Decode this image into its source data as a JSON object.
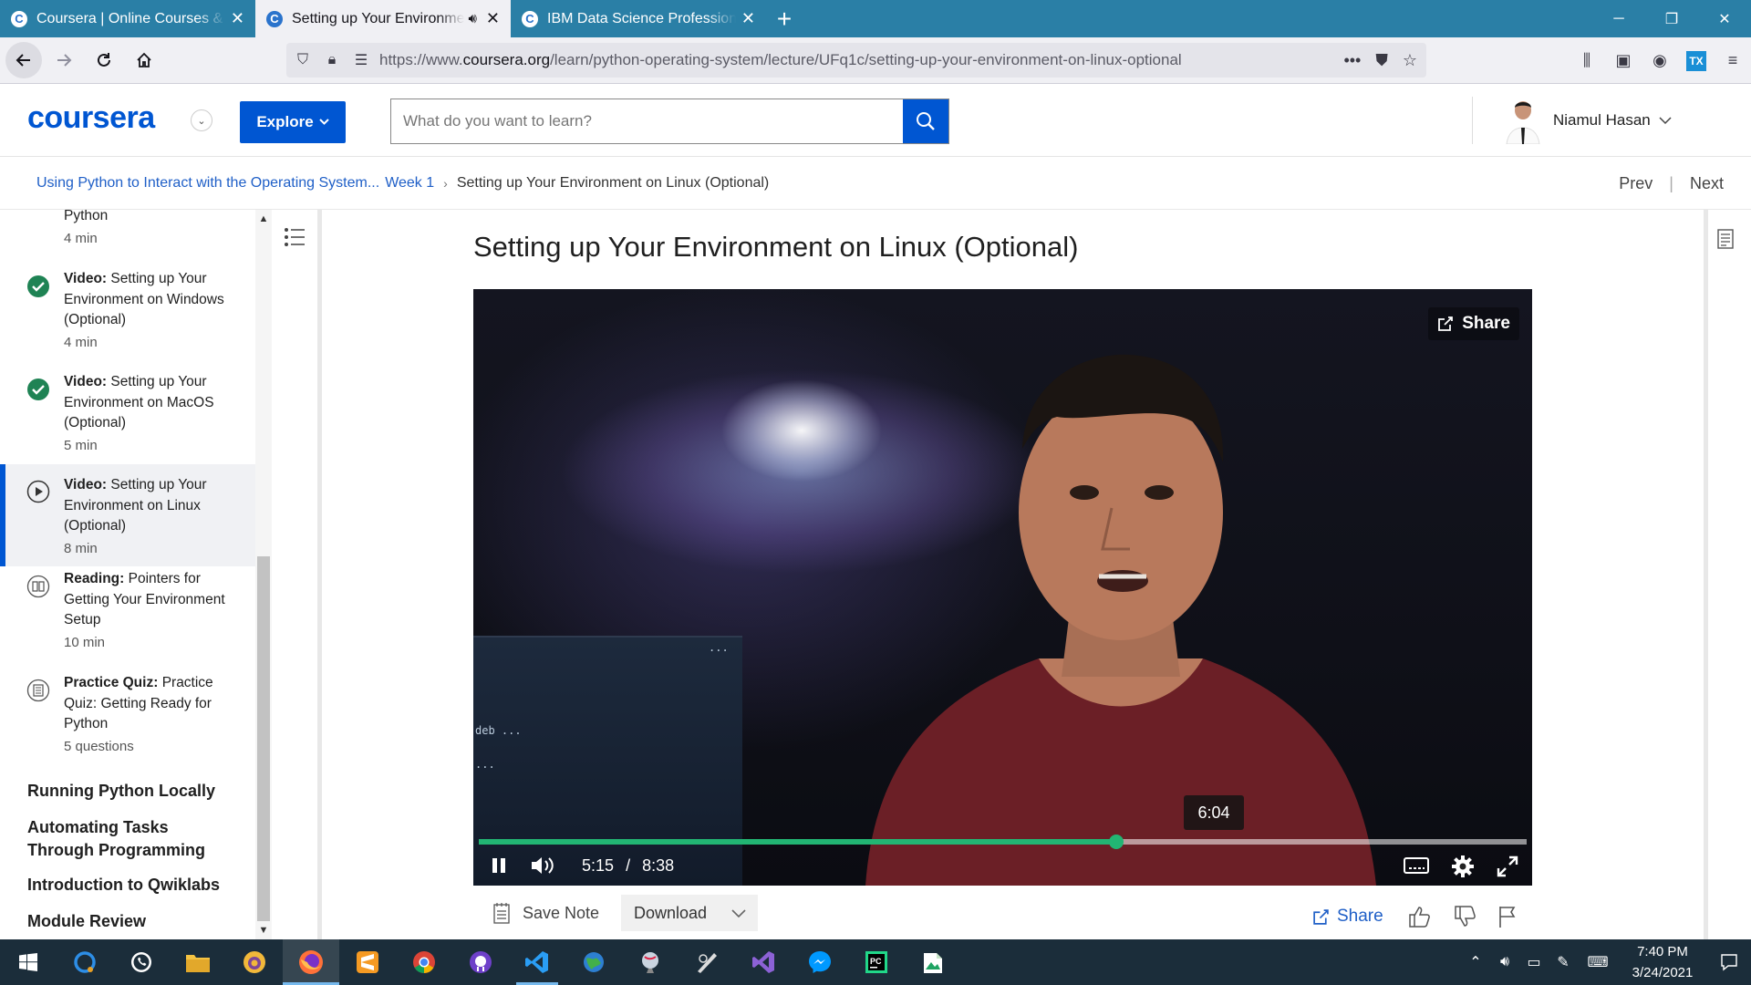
{
  "browser": {
    "tabs": [
      {
        "title": "Coursera | Online Courses & Credentials From Top Educators",
        "active": false,
        "audio": false
      },
      {
        "title": "Setting up Your Environment on Linux (Optional)",
        "active": true,
        "audio": true
      },
      {
        "title": "IBM Data Science Professional Certificate",
        "active": false,
        "audio": false
      }
    ],
    "url_prefix": "https://www.",
    "url_domain": "coursera.org",
    "url_path": "/learn/python-operating-system/lecture/UFq1c/setting-up-your-environment-on-linux-optional",
    "tab_color": "#2a7fa6"
  },
  "header": {
    "logo": "coursera",
    "explore_label": "Explore",
    "search_placeholder": "What do you want to learn?",
    "user_name": "Niamul Hasan",
    "brand_color": "#0056d2"
  },
  "breadcrumb": {
    "course": "Using Python to Interact with the Operating System...",
    "week": "Week 1",
    "current": "Setting up Your Environment on Linux (Optional)",
    "prev_label": "Prev",
    "next_label": "Next"
  },
  "sidebar": {
    "items": [
      {
        "type": "",
        "title": "Python",
        "duration": "4 min",
        "status": "partial"
      },
      {
        "type": "Video:",
        "title": "Setting up Your Environment on Windows (Optional)",
        "duration": "4 min",
        "status": "completed"
      },
      {
        "type": "Video:",
        "title": "Setting up Your Environment on MacOS (Optional)",
        "duration": "5 min",
        "status": "completed"
      },
      {
        "type": "Video:",
        "title": "Setting up Your Environment on Linux (Optional)",
        "duration": "8 min",
        "status": "playing"
      },
      {
        "type": "Reading:",
        "title": "Pointers for Getting Your Environment Setup",
        "duration": "10 min",
        "status": "reading"
      },
      {
        "type": "Practice Quiz:",
        "title": "Practice Quiz: Getting Ready for Python",
        "duration": "5 questions",
        "status": "quiz"
      }
    ],
    "sections": [
      "Running Python Locally",
      "Automating Tasks Through Programming",
      "Introduction to Qwiklabs",
      "Module Review"
    ]
  },
  "main": {
    "title": "Setting up Your Environment on Linux (Optional)",
    "video": {
      "share_label": "Share",
      "current_time": "5:15",
      "time_separator": "/",
      "duration": "8:38",
      "hover_time": "6:04",
      "progress_fraction": 0.608,
      "progress_color": "#22b573",
      "screen_text_1": "deb ...",
      "screen_text_2": "..."
    },
    "toolbar": {
      "save_note_label": "Save Note",
      "download_label": "Download",
      "share_label": "Share"
    }
  },
  "taskbar": {
    "apps": [
      "windows-start",
      "cortana",
      "whatsapp",
      "file-explorer",
      "tor-browser",
      "firefox",
      "sublime",
      "chrome",
      "github-desktop",
      "vscode",
      "earth",
      "stress-ball",
      "wacom",
      "visual-studio",
      "messenger",
      "pycharm",
      "spreadsheet"
    ],
    "time": "7:40 PM",
    "date": "3/24/2021"
  }
}
